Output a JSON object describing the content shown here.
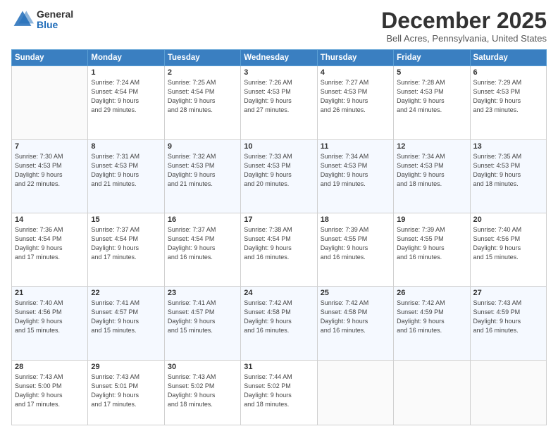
{
  "header": {
    "logo_general": "General",
    "logo_blue": "Blue",
    "title": "December 2025",
    "subtitle": "Bell Acres, Pennsylvania, United States"
  },
  "calendar": {
    "days_of_week": [
      "Sunday",
      "Monday",
      "Tuesday",
      "Wednesday",
      "Thursday",
      "Friday",
      "Saturday"
    ],
    "weeks": [
      [
        {
          "day": "",
          "info": ""
        },
        {
          "day": "1",
          "info": "Sunrise: 7:24 AM\nSunset: 4:54 PM\nDaylight: 9 hours\nand 29 minutes."
        },
        {
          "day": "2",
          "info": "Sunrise: 7:25 AM\nSunset: 4:54 PM\nDaylight: 9 hours\nand 28 minutes."
        },
        {
          "day": "3",
          "info": "Sunrise: 7:26 AM\nSunset: 4:53 PM\nDaylight: 9 hours\nand 27 minutes."
        },
        {
          "day": "4",
          "info": "Sunrise: 7:27 AM\nSunset: 4:53 PM\nDaylight: 9 hours\nand 26 minutes."
        },
        {
          "day": "5",
          "info": "Sunrise: 7:28 AM\nSunset: 4:53 PM\nDaylight: 9 hours\nand 24 minutes."
        },
        {
          "day": "6",
          "info": "Sunrise: 7:29 AM\nSunset: 4:53 PM\nDaylight: 9 hours\nand 23 minutes."
        }
      ],
      [
        {
          "day": "7",
          "info": "Sunrise: 7:30 AM\nSunset: 4:53 PM\nDaylight: 9 hours\nand 22 minutes."
        },
        {
          "day": "8",
          "info": "Sunrise: 7:31 AM\nSunset: 4:53 PM\nDaylight: 9 hours\nand 21 minutes."
        },
        {
          "day": "9",
          "info": "Sunrise: 7:32 AM\nSunset: 4:53 PM\nDaylight: 9 hours\nand 21 minutes."
        },
        {
          "day": "10",
          "info": "Sunrise: 7:33 AM\nSunset: 4:53 PM\nDaylight: 9 hours\nand 20 minutes."
        },
        {
          "day": "11",
          "info": "Sunrise: 7:34 AM\nSunset: 4:53 PM\nDaylight: 9 hours\nand 19 minutes."
        },
        {
          "day": "12",
          "info": "Sunrise: 7:34 AM\nSunset: 4:53 PM\nDaylight: 9 hours\nand 18 minutes."
        },
        {
          "day": "13",
          "info": "Sunrise: 7:35 AM\nSunset: 4:53 PM\nDaylight: 9 hours\nand 18 minutes."
        }
      ],
      [
        {
          "day": "14",
          "info": "Sunrise: 7:36 AM\nSunset: 4:54 PM\nDaylight: 9 hours\nand 17 minutes."
        },
        {
          "day": "15",
          "info": "Sunrise: 7:37 AM\nSunset: 4:54 PM\nDaylight: 9 hours\nand 17 minutes."
        },
        {
          "day": "16",
          "info": "Sunrise: 7:37 AM\nSunset: 4:54 PM\nDaylight: 9 hours\nand 16 minutes."
        },
        {
          "day": "17",
          "info": "Sunrise: 7:38 AM\nSunset: 4:54 PM\nDaylight: 9 hours\nand 16 minutes."
        },
        {
          "day": "18",
          "info": "Sunrise: 7:39 AM\nSunset: 4:55 PM\nDaylight: 9 hours\nand 16 minutes."
        },
        {
          "day": "19",
          "info": "Sunrise: 7:39 AM\nSunset: 4:55 PM\nDaylight: 9 hours\nand 16 minutes."
        },
        {
          "day": "20",
          "info": "Sunrise: 7:40 AM\nSunset: 4:56 PM\nDaylight: 9 hours\nand 15 minutes."
        }
      ],
      [
        {
          "day": "21",
          "info": "Sunrise: 7:40 AM\nSunset: 4:56 PM\nDaylight: 9 hours\nand 15 minutes."
        },
        {
          "day": "22",
          "info": "Sunrise: 7:41 AM\nSunset: 4:57 PM\nDaylight: 9 hours\nand 15 minutes."
        },
        {
          "day": "23",
          "info": "Sunrise: 7:41 AM\nSunset: 4:57 PM\nDaylight: 9 hours\nand 15 minutes."
        },
        {
          "day": "24",
          "info": "Sunrise: 7:42 AM\nSunset: 4:58 PM\nDaylight: 9 hours\nand 16 minutes."
        },
        {
          "day": "25",
          "info": "Sunrise: 7:42 AM\nSunset: 4:58 PM\nDaylight: 9 hours\nand 16 minutes."
        },
        {
          "day": "26",
          "info": "Sunrise: 7:42 AM\nSunset: 4:59 PM\nDaylight: 9 hours\nand 16 minutes."
        },
        {
          "day": "27",
          "info": "Sunrise: 7:43 AM\nSunset: 4:59 PM\nDaylight: 9 hours\nand 16 minutes."
        }
      ],
      [
        {
          "day": "28",
          "info": "Sunrise: 7:43 AM\nSunset: 5:00 PM\nDaylight: 9 hours\nand 17 minutes."
        },
        {
          "day": "29",
          "info": "Sunrise: 7:43 AM\nSunset: 5:01 PM\nDaylight: 9 hours\nand 17 minutes."
        },
        {
          "day": "30",
          "info": "Sunrise: 7:43 AM\nSunset: 5:02 PM\nDaylight: 9 hours\nand 18 minutes."
        },
        {
          "day": "31",
          "info": "Sunrise: 7:44 AM\nSunset: 5:02 PM\nDaylight: 9 hours\nand 18 minutes."
        },
        {
          "day": "",
          "info": ""
        },
        {
          "day": "",
          "info": ""
        },
        {
          "day": "",
          "info": ""
        }
      ]
    ]
  }
}
